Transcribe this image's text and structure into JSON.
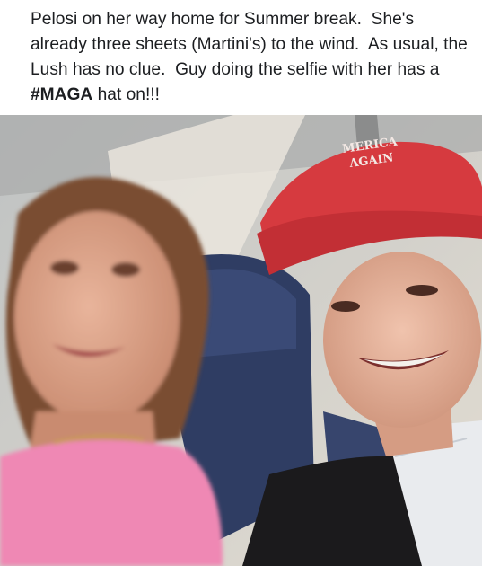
{
  "post": {
    "caption": {
      "before_bold": "Pelosi on her way home for Summer break.  She's already three sheets (Martini's) to the wind.  As usual, the Lush has no clue.  Guy doing the selfie with her has a ",
      "bold": "#MAGA",
      "after_bold": " hat on!!!"
    },
    "photo": {
      "hat_text_line1": "MERICA",
      "hat_text_line2": "AGAIN",
      "colors": {
        "hat": "#d63a3f",
        "pink_top": "#ef88b4",
        "seat": "#2f3d63",
        "jacket": "#1b1a1c",
        "cabin": "#d8d2c9"
      }
    }
  }
}
